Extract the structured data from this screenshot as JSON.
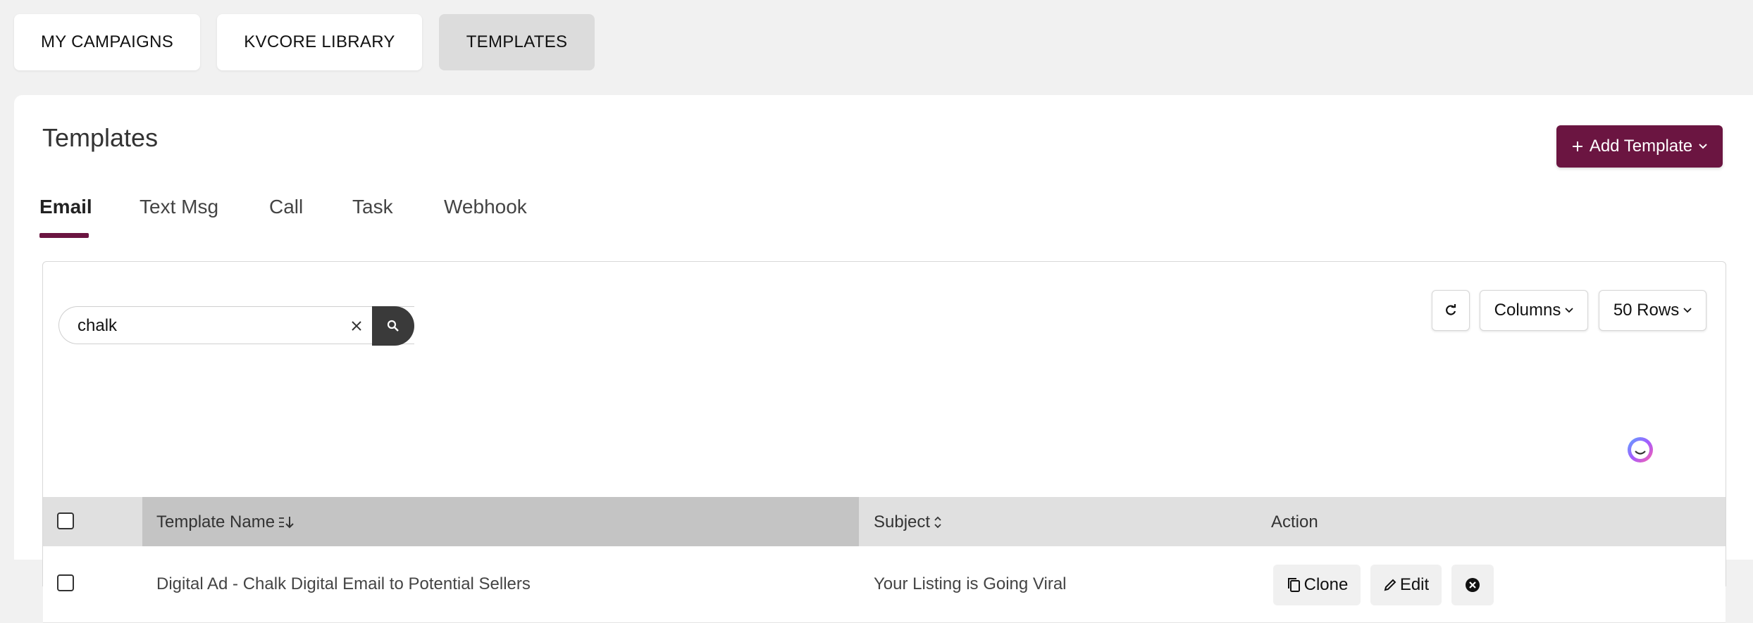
{
  "top_tabs": [
    {
      "label": "MY CAMPAIGNS"
    },
    {
      "label": "KVCORE LIBRARY"
    },
    {
      "label": "TEMPLATES"
    }
  ],
  "page": {
    "title": "Templates",
    "add_button_label": "Add Template"
  },
  "sub_tabs": [
    {
      "label": "Email"
    },
    {
      "label": "Text Msg"
    },
    {
      "label": "Call"
    },
    {
      "label": "Task"
    },
    {
      "label": "Webhook"
    }
  ],
  "search": {
    "value": "chalk"
  },
  "toolbar": {
    "columns_label": "Columns",
    "rows_label": "50 Rows"
  },
  "table": {
    "columns": [
      "Template Name",
      "Subject",
      "Action"
    ],
    "rows": [
      {
        "name": "Digital Ad - Chalk Digital Email to Potential Sellers",
        "subject": "Your Listing is Going Viral",
        "actions": {
          "clone": "Clone",
          "edit": "Edit"
        }
      }
    ]
  },
  "colors": {
    "accent": "#6b1541",
    "active_tab_bg": "#dcdcdc",
    "header_bg": "#e0e0e0",
    "sorted_header_bg": "#c4c4c4"
  },
  "icons": [
    "arrow-right-icon",
    "plus-icon",
    "chevron-down-icon",
    "clear-icon",
    "search-icon",
    "refresh-icon",
    "sort-icon",
    "copy-icon",
    "pencil-icon",
    "close-circle-icon",
    "assistant-icon"
  ]
}
